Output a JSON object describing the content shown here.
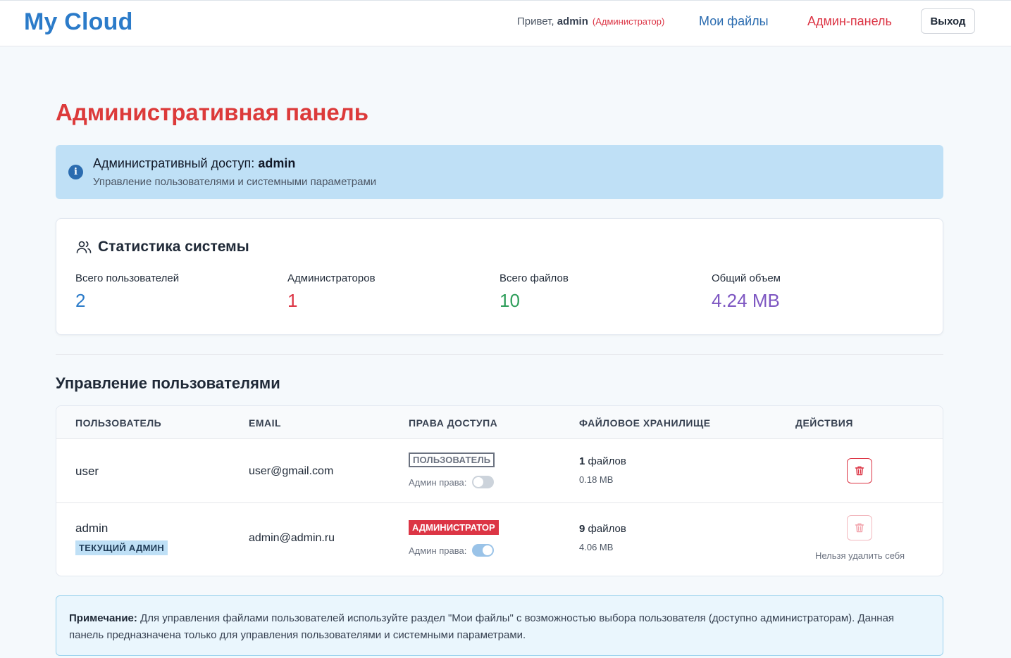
{
  "header": {
    "logo": "My Cloud",
    "greeting_prefix": "Привет, ",
    "username": "admin",
    "role": "(Администратор)",
    "nav_files": "Мои файлы",
    "nav_admin": "Админ-панель",
    "logout": "Выход"
  },
  "page": {
    "title": "Административная панель"
  },
  "alert": {
    "title_prefix": "Административный доступ: ",
    "title_user": "admin",
    "subtitle": "Управление пользователями и системными параметрами",
    "icon": "info-icon",
    "color": "#bfe0f6"
  },
  "stats": {
    "title": "Статистика системы",
    "icon": "users-icon",
    "items": [
      {
        "label": "Всего пользователей",
        "value": "2",
        "color": "#2b7bc9"
      },
      {
        "label": "Администраторов",
        "value": "1",
        "color": "#dc3545"
      },
      {
        "label": "Всего файлов",
        "value": "10",
        "color": "#2f9e5b"
      },
      {
        "label": "Общий объем",
        "value": "4.24 MB",
        "color": "#7e57c2"
      }
    ]
  },
  "users": {
    "title": "Управление пользователями",
    "columns": [
      "ПОЛЬЗОВАТЕЛЬ",
      "EMAIL",
      "ПРАВА ДОСТУПА",
      "ФАЙЛОВОЕ ХРАНИЛИЩЕ",
      "ДЕЙСТВИЯ"
    ],
    "rows": [
      {
        "username": "user",
        "email": "user@gmail.com",
        "role_badge": "ПОЛЬЗОВАТЕЛЬ",
        "admin_label": "Админ права:",
        "admin_enabled": false,
        "files_count": "1",
        "files_word": " файлов",
        "size": "0.18 MB",
        "delete_enabled": true
      },
      {
        "username": "admin",
        "current_badge": "ТЕКУЩИЙ АДМИН",
        "email": "admin@admin.ru",
        "role_badge": "АДМИНИСТРАТОР",
        "admin_label": "Админ права:",
        "admin_enabled": true,
        "files_count": "9",
        "files_word": " файлов",
        "size": "4.06 MB",
        "delete_enabled": false,
        "delete_note": "Нельзя удалить себя"
      }
    ]
  },
  "note": {
    "label": "Примечание:",
    "text": " Для управления файлами пользователей используйте раздел \"Мои файлы\" с возможностью выбора пользователя (доступно администраторам). Данная панель предназначена только для управления пользователями и системными параметрами."
  }
}
